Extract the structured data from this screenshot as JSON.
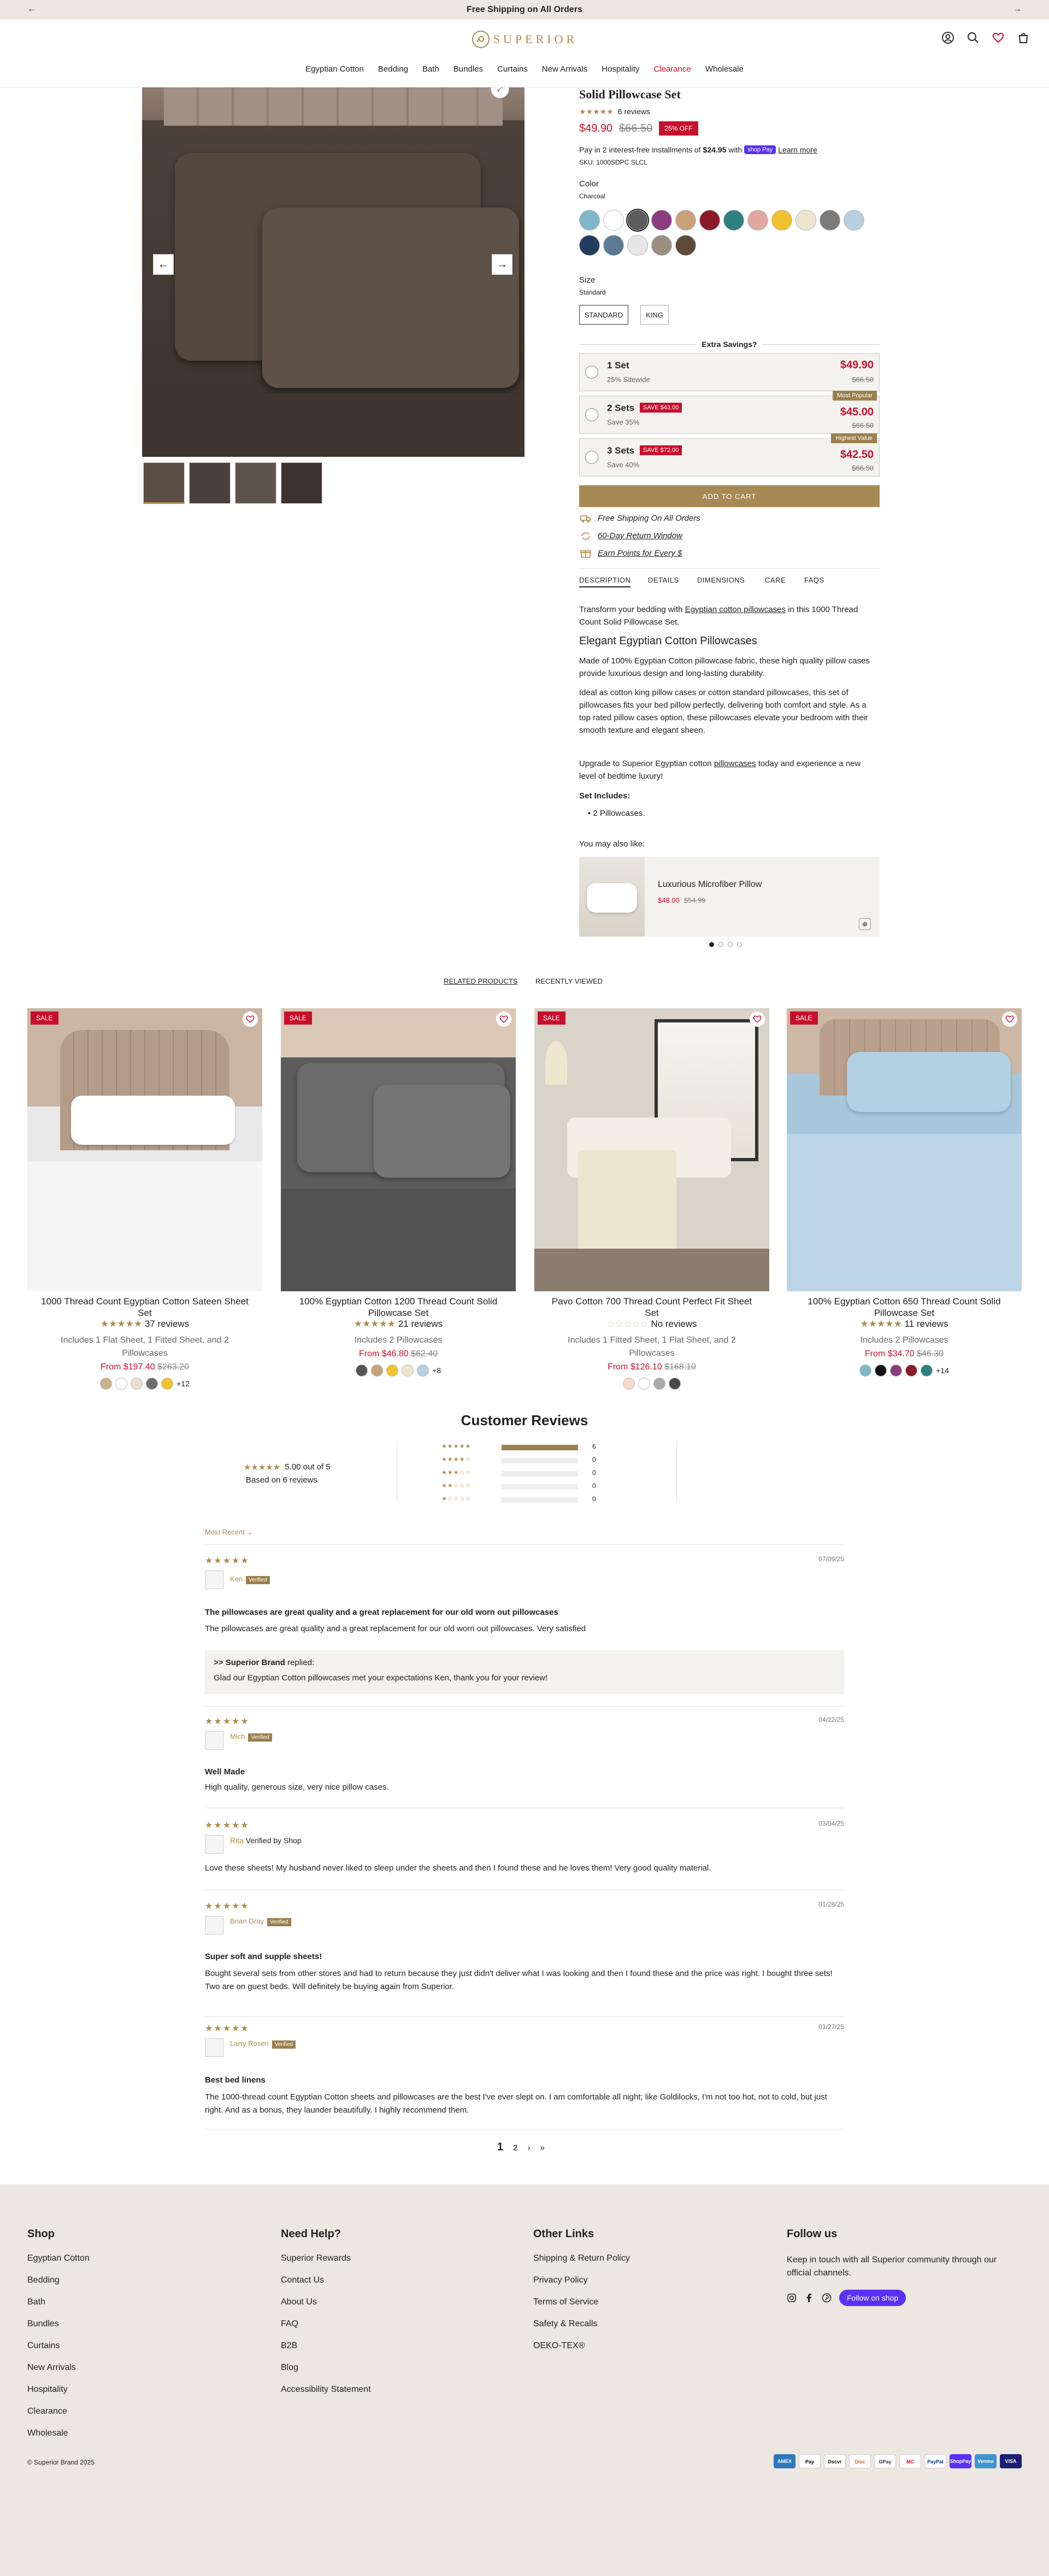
{
  "announcement": {
    "text": "Free Shipping on All Orders"
  },
  "brand": {
    "name": "SUPERIOR"
  },
  "nav": [
    "Egyptian Cotton",
    "Bedding",
    "Bath",
    "Bundles",
    "Curtains",
    "New Arrivals",
    "Hospitality",
    "Clearance",
    "Wholesale"
  ],
  "product": {
    "title": "Solid Pillowcase Set",
    "reviews": "6 reviews",
    "price": "$49.90",
    "compare_price": "$66.50",
    "discount": "25% OFF",
    "installments_pre": "Pay in 2 interest-free installments of",
    "installments_amount": "$24.95",
    "installments_with": "with",
    "shoppay": "shop Pay",
    "learn_more": "Learn more",
    "sku": "SKU: 1000SDPC SLCL",
    "color_label": "Color",
    "color_value": "Charcoal",
    "colors": [
      "#7fb7c8",
      "#ffffff",
      "#5d5d5d",
      "#8a3c7e",
      "#c9a27a",
      "#8b1a2b",
      "#2f7f83",
      "#e3a7a2",
      "#f2c12e",
      "#efe4cf",
      "#7b7b7b",
      "#b7cfdf",
      "#233b5e",
      "#5c7a93",
      "#e7e7e7",
      "#9a8f80",
      "#5b4a3a"
    ],
    "size_label": "Size",
    "size_value": "Standard",
    "sizes": [
      "STANDARD",
      "KING"
    ],
    "extra_savings": "Extra Savings?",
    "bundles": [
      {
        "name": "1 Set",
        "sub": "25% Sitewide",
        "price": "$49.90",
        "old": "$66.50",
        "save": "",
        "tag": ""
      },
      {
        "name": "2 Sets",
        "sub": "Save 35%",
        "price": "$45.00",
        "old": "$66.50",
        "save": "SAVE $43.00",
        "tag": "Most Popular"
      },
      {
        "name": "3 Sets",
        "sub": "Save 40%",
        "price": "$42.50",
        "old": "$66.50",
        "save": "SAVE $72.00",
        "tag": "Highest Value"
      }
    ],
    "add_to_cart": "ADD TO CART",
    "perks": [
      "Free Shipping On All Orders",
      "60-Day Return Window",
      "Earn Points for Every $"
    ],
    "tabs": [
      "DESCRIPTION",
      "DETAILS",
      "DIMENSIONS",
      "CARE",
      "FAQS"
    ],
    "desc_intro_a": "Transform your bedding with",
    "desc_intro_link": "Egyptian cotton pillowcases",
    "desc_intro_b": "in this 1000 Thread Count Solid Pillowcase Set.",
    "desc_heading": "Elegant Egyptian Cotton Pillowcases",
    "desc_p1": "Made of 100% Egyptian Cotton pillowcase fabric, these high quality pillow cases provide luxurious design and long-lasting durability.",
    "desc_p2": "Ideal as cotton king pillow cases or cotton standard pillowcases, this set of pillowcases fits your bed pillow perfectly, delivering both comfort and style. As a top rated pillow cases option, these pillowcases elevate your bedroom with their smooth texture and elegant sheen.",
    "desc_p3_a": "Upgrade to Superior Egyptian cotton",
    "desc_p3_link": "pillowcases",
    "desc_p3_b": "today and experience a new level of bedtime luxury!",
    "set_includes_label": "Set Includes:",
    "set_includes_item": "2 Pillowcases.",
    "also_like_label": "You may also like:",
    "also_like_name": "Luxurious Microfiber Pillow",
    "also_like_price": "$48.00",
    "also_like_old": "$54.99"
  },
  "related_tabs": [
    "RELATED PRODUCTS",
    "RECENTLY VIEWED"
  ],
  "related": [
    {
      "sale": "SALE",
      "title": "1000 Thread Count Egyptian Cotton Sateen Sheet Set",
      "reviews": "37 reviews",
      "includes": "Includes 1 Flat Sheet, 1 Fitted Sheet, and 2 Pillowcases",
      "from": "From $197.40",
      "old": "$263.20",
      "more": "+12",
      "stars": 5,
      "swatches": [
        "#c9b28b",
        "#ffffff",
        "#e8dfd2",
        "#6d6d6d",
        "#f2c12e"
      ]
    },
    {
      "sale": "SALE",
      "title": "100% Egyptian Cotton 1200 Thread Count Solid Pillowcase Set",
      "reviews": "21 reviews",
      "includes": "Includes 2 Pillowcases",
      "from": "From $46.80",
      "old": "$62.40",
      "more": "+8",
      "stars": 5,
      "swatches": [
        "#555555",
        "#c9a27a",
        "#f2c12e",
        "#efe4cf",
        "#b7cfdf"
      ]
    },
    {
      "sale": "SALE",
      "title": "Pavo Cotton 700 Thread Count Perfect Fit Sheet Set",
      "reviews": "No reviews",
      "includes": "Includes 1 Fitted Sheet, 1 Flat Sheet, and 2 Pillowcases",
      "from": "From $126.10",
      "old": "$168.10",
      "more": "",
      "stars": 0,
      "swatches": [
        "#f3d9c9",
        "#ffffff",
        "#a9a9a9",
        "#4a4a4a"
      ]
    },
    {
      "sale": "SALE",
      "title": "100% Egyptian Cotton 650 Thread Count Solid Pillowcase Set",
      "reviews": "11 reviews",
      "includes": "Includes 2 Pillowcases",
      "from": "From $34.70",
      "old": "$46.30",
      "more": "+14",
      "stars": 5,
      "swatches": [
        "#7fb7c8",
        "#111111",
        "#8a3c7e",
        "#8b1a2b",
        "#2f7f83"
      ]
    }
  ],
  "customer_reviews": {
    "title": "Customer Reviews",
    "average": "5.00 out of 5",
    "based_on": "Based on 6 reviews",
    "histogram": [
      {
        "stars": 5,
        "count": "6",
        "fraction": 1
      },
      {
        "stars": 4,
        "count": "0",
        "fraction": 0
      },
      {
        "stars": 3,
        "count": "0",
        "fraction": 0
      },
      {
        "stars": 2,
        "count": "0",
        "fraction": 0
      },
      {
        "stars": 1,
        "count": "0",
        "fraction": 0
      }
    ],
    "sort": "Most Recent",
    "verified": "Verified",
    "items": [
      {
        "name": "Ken",
        "date": "07/09/25",
        "title": "The pillowcases are great quality and a great replacement for our old worn out pillowcases",
        "body": "The pillowcases are great quality and a great replacement for our old worn out pillowcases. Very satisfied",
        "reply_by": "Superior Brand",
        "reply_word": "replied:",
        "reply": "Glad our Egyptian Cotton pillowcases met your expectations Ken, thank you for your review!"
      },
      {
        "name": "Mich",
        "date": "04/22/25",
        "title": "Well Made",
        "body": "High quality, generous size, very nice pillow cases."
      },
      {
        "name": "Rita",
        "verified_text": "Verified by Shop",
        "date": "03/04/25",
        "title": "",
        "body": "Love these sheets! My husband never liked to sleep under the sheets and then I found these and he loves them! Very good quality material."
      },
      {
        "name": "Brian Gray",
        "date": "01/28/25",
        "title": "Super soft and supple sheets!",
        "body": "Bought several sets from other stores and had to return because they just didn't deliver what I was looking and then I found these and the price was right. I bought three sets! Two are on guest beds. Will definitely be buying again from Superior."
      },
      {
        "name": "Larry Rosen",
        "date": "01/27/25",
        "title": "Best bed linens",
        "body": "The 1000-thread count Egyptian Cotton sheets and pillowcases are the best I've ever slept on. I am comfortable all night; like Goldilocks, I'm not too hot, not to cold, but just right. And as a bonus, they launder beautifully. I highly recommend them."
      }
    ],
    "pages": [
      "1",
      "2",
      "›",
      "»"
    ]
  },
  "footer": {
    "shop_title": "Shop",
    "shop": [
      "Egyptian Cotton",
      "Bedding",
      "Bath",
      "Bundles",
      "Curtains",
      "New Arrivals",
      "Hospitality",
      "Clearance",
      "Wholesale"
    ],
    "help_title": "Need Help?",
    "help": [
      "Superior Rewards",
      "Contact Us",
      "About Us",
      "FAQ",
      "B2B",
      "Blog",
      "Accessibility Statement"
    ],
    "other_title": "Other Links",
    "other": [
      "Shipping & Return Policy",
      "Privacy Policy",
      "Terms of Service",
      "Safety & Recalls",
      "OEKO-TEX®"
    ],
    "follow_title": "Follow us",
    "follow_text": "Keep in touch with all Superior community through our official channels.",
    "follow_shop": "Follow on shop",
    "copyright": "© Superior Brand 2025",
    "payments": [
      "AMEX",
      "Pay",
      "Dscvr",
      "Disc",
      "GPay",
      "MC",
      "PayPal",
      "ShopPay",
      "Venmo",
      "VISA"
    ]
  },
  "colors": {
    "accent": "#b08a4a",
    "sale": "#c8102e",
    "cart": "#a68a55",
    "footer_bg": "#ece7e0"
  }
}
